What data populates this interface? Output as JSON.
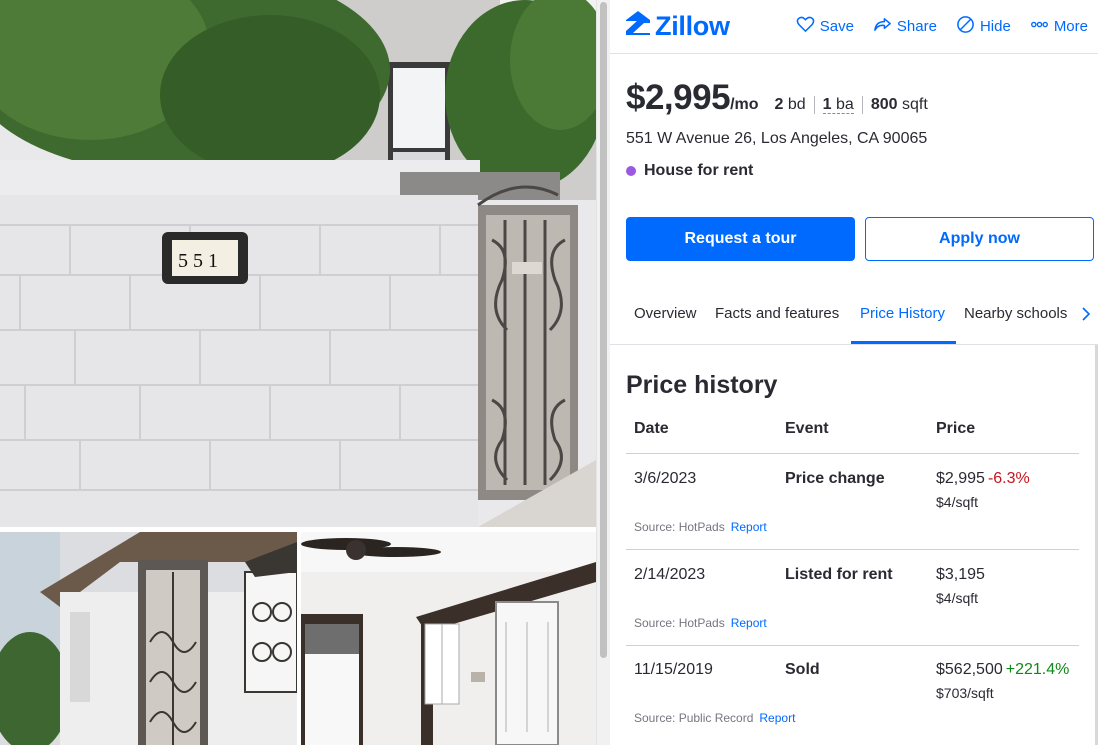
{
  "brand": {
    "name": "Zillow",
    "color": "#006aff",
    "icon": "zillow-logo-icon"
  },
  "header_actions": [
    {
      "label": "Save",
      "icon": "heart-icon"
    },
    {
      "label": "Share",
      "icon": "share-icon"
    },
    {
      "label": "Hide",
      "icon": "hide-icon"
    },
    {
      "label": "More",
      "icon": "more-dots-icon"
    }
  ],
  "listing": {
    "price": "$2,995",
    "price_unit": "/mo",
    "beds_value": "2",
    "beds_unit": "bd",
    "baths_value": "1",
    "baths_unit": "ba",
    "sqft_value": "800",
    "sqft_unit": "sqft",
    "address": "551 W Avenue 26, Los Angeles, CA 90065",
    "status": "House for rent",
    "status_color": "#9b59e0"
  },
  "cta": {
    "tour": "Request a tour",
    "apply": "Apply now"
  },
  "tabs": [
    {
      "label": "Overview",
      "active": false
    },
    {
      "label": "Facts and features",
      "active": false
    },
    {
      "label": "Price History",
      "active": true
    },
    {
      "label": "Nearby schools",
      "active": false
    }
  ],
  "price_history": {
    "title": "Price history",
    "columns": [
      "Date",
      "Event",
      "Price"
    ],
    "rows": [
      {
        "date": "3/6/2023",
        "event": "Price change",
        "price": "$2,995",
        "change": "-6.3%",
        "per_sqft": "$4/sqft",
        "source": "Source: HotPads",
        "report": "Report"
      },
      {
        "date": "2/14/2023",
        "event": "Listed for rent",
        "price": "$3,195",
        "change": "",
        "per_sqft": "$4/sqft",
        "source": "Source: HotPads",
        "report": "Report"
      },
      {
        "date": "11/15/2019",
        "event": "Sold",
        "price": "$562,500",
        "change": "+221.4%",
        "per_sqft": "$703/sqft",
        "source": "Source: Public Record",
        "report": "Report"
      }
    ]
  },
  "colors": {
    "negative": "#c5141d",
    "positive": "#0e8a16"
  }
}
